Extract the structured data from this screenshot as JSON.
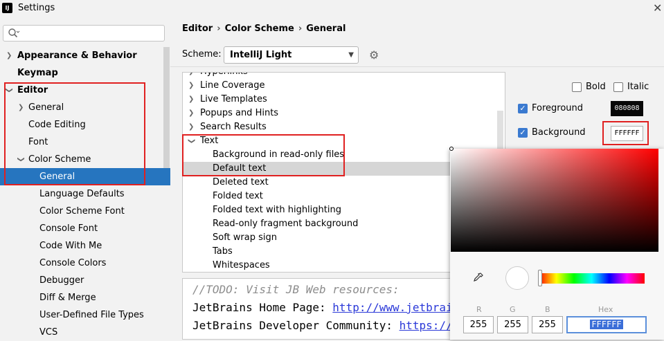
{
  "window": {
    "title": "Settings",
    "logo": "IJ"
  },
  "sidebar": {
    "search_placeholder": "",
    "items": [
      {
        "label": "Appearance & Behavior"
      },
      {
        "label": "Keymap"
      },
      {
        "label": "Editor"
      },
      {
        "label": "General"
      },
      {
        "label": "Code Editing"
      },
      {
        "label": "Font"
      },
      {
        "label": "Color Scheme"
      },
      {
        "label": "General"
      },
      {
        "label": "Language Defaults"
      },
      {
        "label": "Color Scheme Font"
      },
      {
        "label": "Console Font"
      },
      {
        "label": "Code With Me"
      },
      {
        "label": "Console Colors"
      },
      {
        "label": "Debugger"
      },
      {
        "label": "Diff & Merge"
      },
      {
        "label": "User-Defined File Types"
      },
      {
        "label": "VCS"
      }
    ]
  },
  "breadcrumb": [
    "Editor",
    "Color Scheme",
    "General"
  ],
  "scheme": {
    "label": "Scheme:",
    "value": "IntelliJ Light"
  },
  "element_tree": {
    "items": [
      {
        "label": "Hyperlinks"
      },
      {
        "label": "Line Coverage"
      },
      {
        "label": "Live Templates"
      },
      {
        "label": "Popups and Hints"
      },
      {
        "label": "Search Results"
      },
      {
        "label": "Text"
      },
      {
        "label": "Background in read-only files"
      },
      {
        "label": "Default text"
      },
      {
        "label": "Deleted text"
      },
      {
        "label": "Folded text"
      },
      {
        "label": "Folded text with highlighting"
      },
      {
        "label": "Read-only fragment background"
      },
      {
        "label": "Soft wrap sign"
      },
      {
        "label": "Tabs"
      },
      {
        "label": "Whitespaces"
      }
    ]
  },
  "options": {
    "bold": "Bold",
    "italic": "Italic",
    "foreground": {
      "label": "Foreground",
      "checked": true,
      "color": "080808"
    },
    "background": {
      "label": "Background",
      "checked": true,
      "color": "FFFFFF"
    }
  },
  "preview": {
    "line1": "//TODO: Visit JB Web resources:",
    "line2_text": "JetBrains Home Page: ",
    "line2_link": "http://www.jetbrains.com",
    "line3_text": "JetBrains Developer Community: ",
    "line3_link": "https://www.jetbrains.com"
  },
  "picker": {
    "labels": {
      "r": "R",
      "g": "G",
      "b": "B",
      "hex": "Hex"
    },
    "r": "255",
    "g": "255",
    "b": "255",
    "hex": "FFFFFF"
  },
  "colors": {
    "selection": "#2675bf",
    "highlight_box": "#e02020",
    "accent": "#3b7ad0"
  }
}
